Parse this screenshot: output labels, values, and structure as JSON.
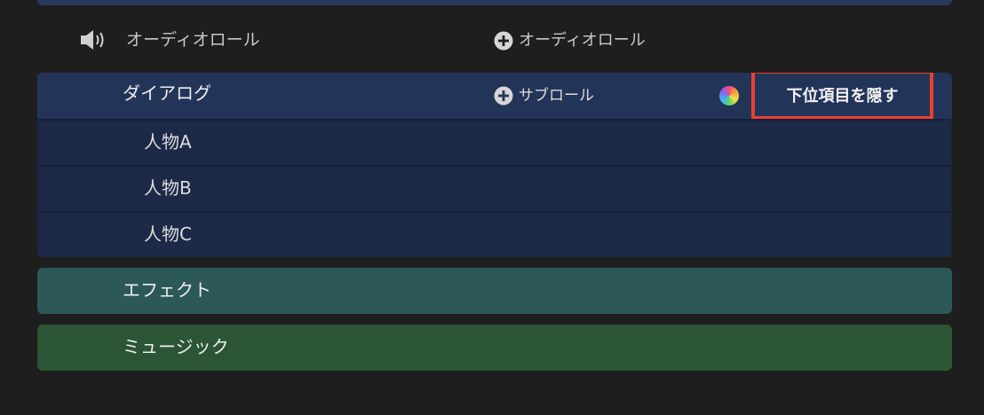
{
  "audio_roles": {
    "section_title": "オーディオロール",
    "add_audio_role_label": "オーディオロール",
    "icons": {
      "speaker": "speaker-icon",
      "add": "plus-circle-icon",
      "color": "color-wheel-icon"
    },
    "dialogue": {
      "label": "ダイアログ",
      "add_subrole_label": "サブロール",
      "hide_subitems_label": "下位項目を隠す",
      "highlight_color": "#e8402c",
      "header_color": "#233459",
      "subroles": [
        {
          "label": "人物A"
        },
        {
          "label": "人物B"
        },
        {
          "label": "人物C"
        }
      ]
    },
    "effects": {
      "label": "エフェクト",
      "color": "#2c5858"
    },
    "music": {
      "label": "ミュージック",
      "color": "#2b5534"
    }
  }
}
